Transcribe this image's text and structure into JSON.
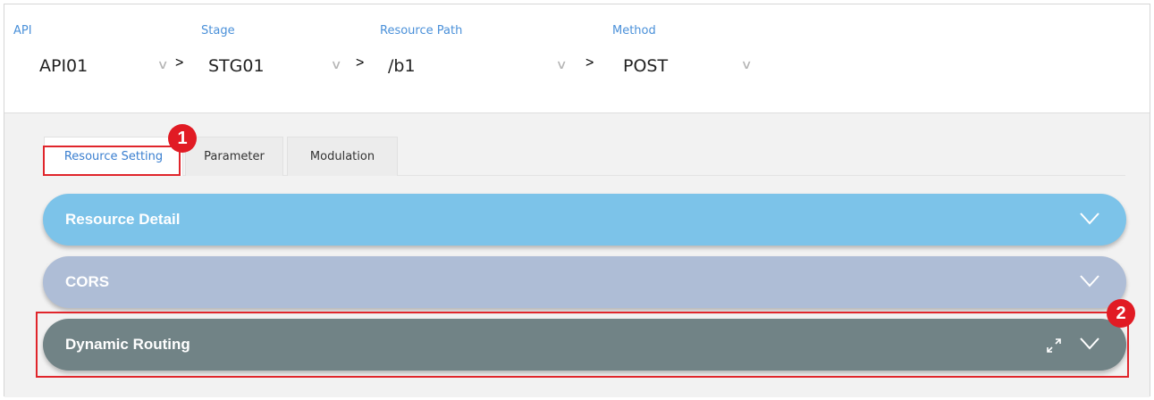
{
  "selectors": [
    {
      "label": "API",
      "value": "API01"
    },
    {
      "label": "Stage",
      "value": "STG01"
    },
    {
      "label": "Resource Path",
      "value": "/b1"
    },
    {
      "label": "Method",
      "value": "POST"
    }
  ],
  "separator": ">",
  "chevron": "∨",
  "tabs": [
    {
      "label": "Resource Setting",
      "active": true
    },
    {
      "label": "Parameter",
      "active": false
    },
    {
      "label": "Modulation",
      "active": false
    }
  ],
  "panels": [
    {
      "title": "Resource Detail",
      "color": "#7cc3e9"
    },
    {
      "title": "CORS",
      "color": "#aebdd6"
    },
    {
      "title": "Dynamic Routing",
      "color": "#718386"
    }
  ],
  "annotations": {
    "badge_1": "1",
    "badge_2": "2",
    "highlight_color": "#e0252b"
  },
  "icons": {
    "dropdown": "chevron-down-icon",
    "breadcrumb": "chevron-right-icon",
    "panel_toggle": "chevron-down-icon",
    "expand": "expand-icon"
  }
}
